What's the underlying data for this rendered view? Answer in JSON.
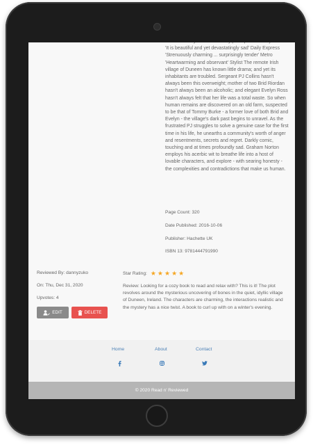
{
  "description": "Times 'a funny and wonderfully perceptive' Wendy Holden 'It is beautiful and yet devastatingly sad' Daily Express 'Strenuously charming ... surprisingly tender' Metro 'Heartwarming and observant' Stylist The remote Irish village of Duneen has known little drama; and yet its inhabitants are troubled. Sergeant PJ Collins hasn't always been this overweight; mother of two Brid Riordan hasn't always been an alcoholic; and elegant Evelyn Ross hasn't always felt that her life was a total waste. So when human remains are discovered on an old farm, suspected to be that of Tommy Burke - a former love of both Brid and Evelyn - the village's dark past begins to unravel. As the frustrated PJ struggles to solve a genuine case for the first time in his life, he unearths a community's worth of anger and resentments, secrets and regret. Darkly comic, touching and at times profoundly sad. Graham Norton employs his acerbic wit to breathe life into a host of lovable characters, and explore - with searing honesty - the complexities and contradictions that make us human.",
  "book": {
    "page_count": "Page Count: 320",
    "date_published": "Date Published: 2016-10-06",
    "publisher": "Publisher: Hachette UK",
    "isbn": "ISBN 13: 9781444791990"
  },
  "review": {
    "reviewed_by": "Reviewed By: dannyzuko",
    "date": "On: Thu, Dec 31, 2020",
    "upvotes": "Upvotes: 4",
    "star_label": "Star Rating:",
    "stars": 5,
    "text": "Review: Looking for a cozy book to read and relax with? This is it! The plot revolves around the mysterious uncovering of bones in the quiet, idyllic village of Duneen, Ireland. The characters are charming, the interactions realistic and the mystery has a nice twist. A book to curl up with on a winter's evening.",
    "edit_label": "EDIT",
    "delete_label": "DELETE"
  },
  "footer": {
    "links": [
      "Home",
      "About",
      "Contact"
    ],
    "social_icons": [
      "facebook-icon",
      "instagram-icon",
      "twitter-icon"
    ],
    "copyright": "© 2020 Read n' Reviewed"
  },
  "colors": {
    "star": "#f5a623",
    "edit_button": "#8a8a8a",
    "delete_button": "#e8524f",
    "link": "#4a7fb5",
    "footer_bar": "#b5b5b5"
  }
}
